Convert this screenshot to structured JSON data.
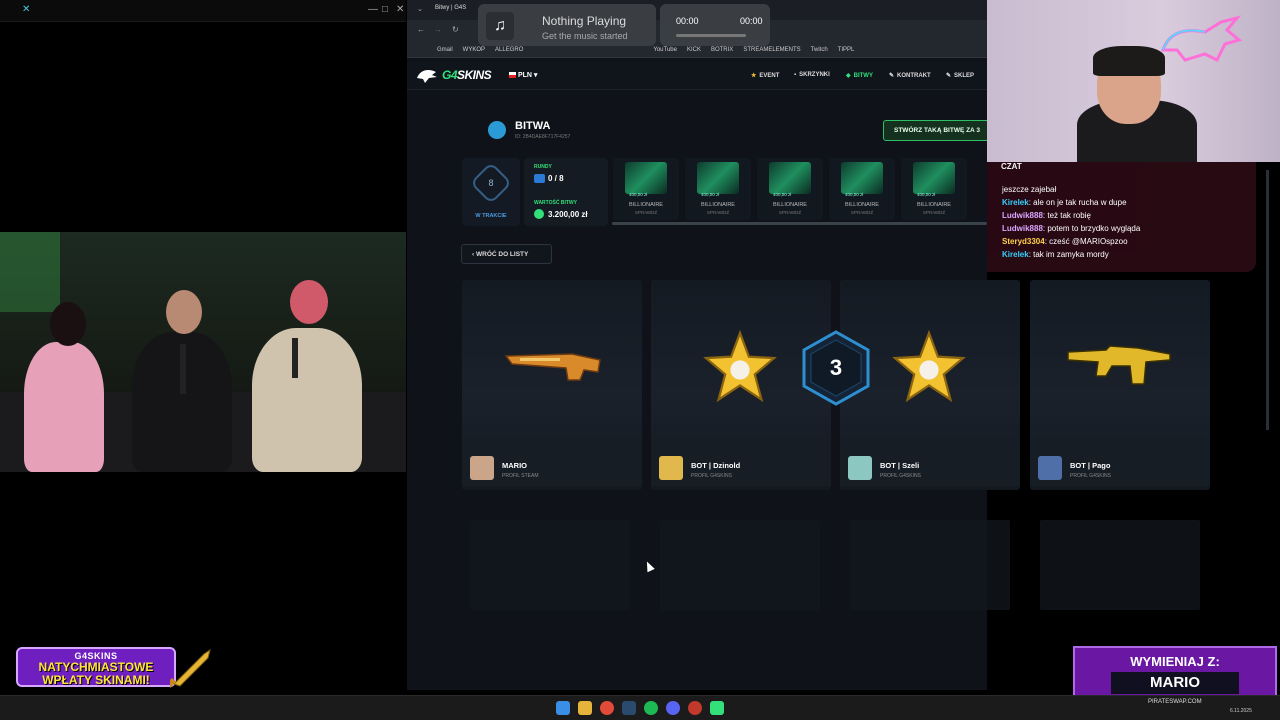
{
  "music_widget": {
    "title": "Nothing Playing",
    "subtitle": "Get the music started",
    "time_start": "00:00",
    "time_end": "00:00"
  },
  "browser": {
    "tab_label": "Bitwy | G4S",
    "bookmarks": [
      "Gmail",
      "WYKOP",
      "ALLEGRO",
      "YouTube",
      "KICK",
      "BOTRIX",
      "STREAMELEMENTS",
      "Twitch",
      "TIPPL"
    ]
  },
  "site": {
    "logo_a": "G4",
    "logo_b": "SKINS",
    "currency": "PLN",
    "nav": [
      {
        "icon": "★",
        "label": "EVENT"
      },
      {
        "icon": "▪",
        "label": "SKRZYNKI"
      },
      {
        "icon": "◆",
        "label": "BITWY"
      },
      {
        "icon": "✎",
        "label": "KONTRAKT"
      },
      {
        "icon": "✎",
        "label": "SKLEP"
      }
    ]
  },
  "battle": {
    "title": "BITWA",
    "id": "ID: 2B4DAE8F717F4257",
    "create_button": "STWÓRZ TAKĄ BITWĘ ZA 3",
    "status_number": "8",
    "status_label": "W TRAKCIE",
    "rounds_label": "RUNDY",
    "rounds_value": "0 / 8",
    "value_label": "WARTOŚĆ BITWY",
    "value_amount": "3.200,00 zł",
    "back_button": "WRÓĆ DO LISTY",
    "round_number": "3",
    "cases": [
      {
        "name": "BILLIONAIRE",
        "price": "400,00 zł",
        "check": "SPRAWDŹ"
      },
      {
        "name": "BILLIONAIRE",
        "price": "400,00 zł",
        "check": "SPRAWDŹ"
      },
      {
        "name": "BILLIONAIRE",
        "price": "400,00 zł",
        "check": "SPRAWDŹ"
      },
      {
        "name": "BILLIONAIRE",
        "price": "400,00 zł",
        "check": "SPRAWDŹ"
      },
      {
        "name": "BILLIONAIRE",
        "price": "400,00 zł",
        "check": "SPRAWDŹ"
      }
    ],
    "players": [
      {
        "name": "MARIO",
        "profile": "PROFIL STEAM",
        "avatar_color": "#caa58a"
      },
      {
        "name": "BOT | Dzinold",
        "profile": "PROFIL G4SKINS",
        "avatar_color": "#e0b84c"
      },
      {
        "name": "BOT | Szeli",
        "profile": "PROFIL G4SKINS",
        "avatar_color": "#8cc7c2"
      },
      {
        "name": "BOT | Pago",
        "profile": "PROFIL G4SKINS",
        "avatar_color": "#4f6fa8"
      }
    ]
  },
  "chat": {
    "header": "CZAT",
    "lines": [
      {
        "user": "",
        "text": "jeszcze zajebał",
        "color": "#ffffff"
      },
      {
        "user": "Kirelek",
        "text": ": ale on je tak rucha w dupe",
        "color": "#35d1ff"
      },
      {
        "user": "Ludwik888",
        "text": ": też tak robię",
        "color": "#d9a6ff"
      },
      {
        "user": "Ludwik888",
        "text": ": potem to brzydko wygląda",
        "color": "#d9a6ff"
      },
      {
        "user": "Steryd3304",
        "text": ": cześć @MARIOspzoo",
        "color": "#ffd24a"
      },
      {
        "user": "Kirelek",
        "text": ": tak im zamyka mordy",
        "color": "#35d1ff"
      }
    ]
  },
  "promo": {
    "brand": "G4SKINS",
    "line1": "NATYCHMIASTOWE",
    "line2": "WPŁATY SKINAMI!"
  },
  "trade": {
    "line1": "WYMIENIAJ Z:",
    "line2": "MARIO",
    "url": "PIRATESWAP.COM"
  },
  "taskbar": {
    "clock": "6.11.2025"
  },
  "colors": {
    "accent_green": "#33e07a",
    "accent_blue": "#2b9bd6",
    "gold": "#f2c230"
  }
}
